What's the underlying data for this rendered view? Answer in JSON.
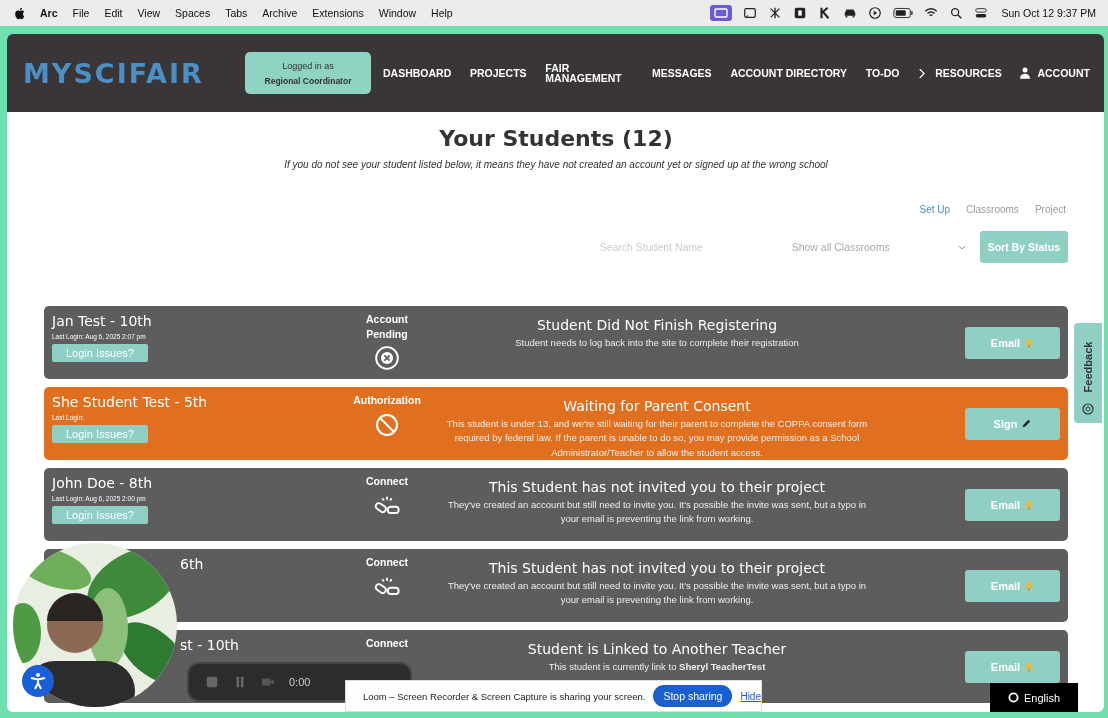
{
  "menubar": {
    "app": "Arc",
    "menus": [
      "File",
      "Edit",
      "View",
      "Spaces",
      "Tabs",
      "Archive",
      "Extensions",
      "Window",
      "Help"
    ],
    "clock": "Sun Oct 12  9:37 PM"
  },
  "header": {
    "logo": "MYSCIFAIR",
    "login_label": "Logged in as",
    "login_role": "Regional Coordinator",
    "nav": [
      {
        "label": "DASHBOARD",
        "kind": "plain"
      },
      {
        "label": "PROJECTS",
        "kind": "plain"
      },
      {
        "label": "FAIR MANAGEMENT",
        "kind": "plain"
      },
      {
        "label": "MESSAGES",
        "kind": "plain"
      },
      {
        "label": "ACCOUNT DIRECTORY",
        "kind": "plain"
      },
      {
        "label": "TO-DO",
        "kind": "plain"
      },
      {
        "label": "RESOURCES",
        "kind": "chevron"
      },
      {
        "label": "ACCOUNT",
        "kind": "user"
      }
    ]
  },
  "page": {
    "title": "Your Students (12)",
    "subtitle": "If you do not see your student listed below, it means they have not created an account yet or signed up at the wrong school",
    "tabs": [
      {
        "label": "Set Up",
        "selected": true
      },
      {
        "label": "Classrooms",
        "selected": false
      },
      {
        "label": "Project",
        "selected": false
      }
    ],
    "search": {
      "placeholder": "Search Student Name"
    },
    "classroom_select": "Show all Classrooms",
    "sort_button": "Sort By Status"
  },
  "students": [
    {
      "name": "Jan Test - 10th",
      "last_login": "Last Login: Aug 6, 2025 2:07 pm",
      "login_button": "Login Issues?",
      "status": "Account Pending",
      "status_icon": {
        "kind": "x-circle"
      },
      "kind": "default",
      "title": "Student Did Not Finish Registering",
      "description": "Student needs to log back into the site to complete their registration",
      "action": "Email"
    },
    {
      "name": "She Student Test - 5th",
      "last_login": "Last Login:",
      "login_button": "Login Issues?",
      "status": "Authorization",
      "status_icon": {
        "kind": "ban"
      },
      "kind": "alert",
      "title": "Waiting for Parent Consent",
      "description": "This student is under 13, and we're still waiting for their parent to complete the COPPA consent form required by federal law. If the parent is unable to do so, you may provide permission as a School Administrator/Teacher to allow the student access.",
      "action": "Sign"
    },
    {
      "name": "John Doe - 8th",
      "last_login": "Last Login: Aug 6, 2025 2:00 pm",
      "login_button": "Login Issues?",
      "status": "Connect",
      "status_icon": {
        "kind": "broken-link"
      },
      "kind": "default",
      "title": "This Student has not invited you to their project",
      "description": "They've created an account but still need to invite you. It's possible the invite was sent, but a typo in your email is preventing the link from working.",
      "action": "Email"
    },
    {
      "name": "6th",
      "name_covered": true,
      "status": "Connect",
      "status_icon": {
        "kind": "broken-link"
      },
      "kind": "default",
      "title": "This Student has not invited you to their project",
      "description": "They've created an account but still need to invite you. It's possible the invite was sent, but a typo in your email is preventing the link from working.",
      "action": "Email"
    },
    {
      "name": "st - 10th",
      "name_covered": true,
      "status": "Connect",
      "kind": "default",
      "title": "Student is Linked to Another Teacher",
      "description": "This student is currently link to **Sheryl TeacherTest**",
      "action": "Email"
    }
  ],
  "feedback_tab": "Feedback",
  "recorder": {
    "time": "0:00"
  },
  "sharing_bar": {
    "message": "Loom – Screen Recorder & Screen Capture is sharing your screen.",
    "stop_button": "Stop sharing",
    "hide_link": "Hide"
  },
  "language_button": "English"
}
